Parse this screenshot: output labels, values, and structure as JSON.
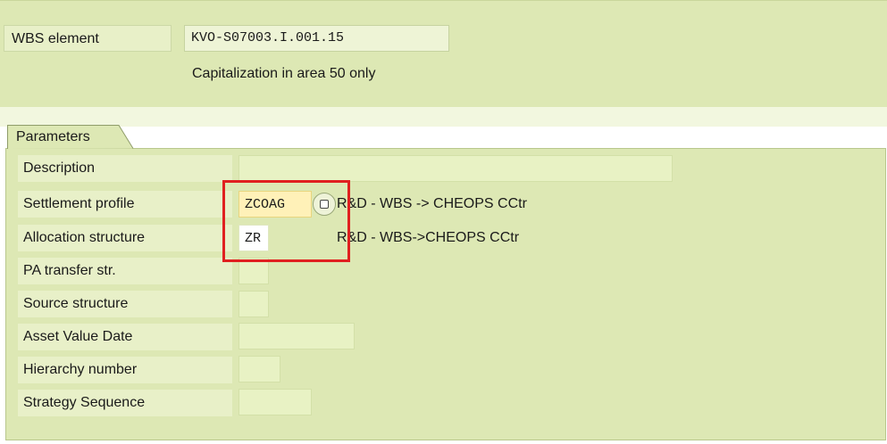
{
  "header": {
    "wbs_label": "WBS element",
    "wbs_value": "KVO-S07003.I.001.15",
    "wbs_note": "Capitalization in area 50 only"
  },
  "parameters": {
    "tab_label": "Parameters",
    "rows": {
      "description": {
        "label": "Description",
        "value": ""
      },
      "settlement_profile": {
        "label": "Settlement profile",
        "value": "ZCOAG",
        "text": "R&D - WBS -> CHEOPS CCtr"
      },
      "allocation_structure": {
        "label": "Allocation structure",
        "value": "ZR",
        "text": "R&D - WBS->CHEOPS CCtr"
      },
      "pa_transfer": {
        "label": "PA transfer str.",
        "value": ""
      },
      "source_structure": {
        "label": "Source structure",
        "value": ""
      },
      "asset_value_date": {
        "label": "Asset Value Date",
        "value": ""
      },
      "hierarchy_number": {
        "label": "Hierarchy number",
        "value": ""
      },
      "strategy_sequence": {
        "label": "Strategy Sequence",
        "value": ""
      }
    }
  },
  "annotation": {
    "highlight_color": "#e02020"
  }
}
